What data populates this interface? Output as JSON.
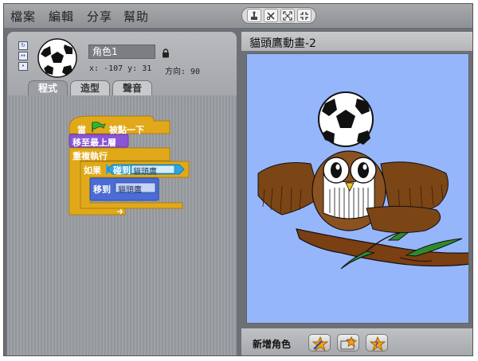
{
  "menu": {
    "items": [
      "檔案",
      "編輯",
      "分享",
      "幫助"
    ]
  },
  "toolbar": {
    "tools": [
      "stamp-icon",
      "scissors-icon",
      "grow-icon",
      "shrink-icon"
    ]
  },
  "sprite": {
    "name": "角色1",
    "coords": "x: -107  y: 31",
    "direction": "方向: 90"
  },
  "tabs": [
    {
      "label": "程式",
      "active": true
    },
    {
      "label": "造型",
      "active": false
    },
    {
      "label": "聲音",
      "active": false
    }
  ],
  "blocks": {
    "when_flag_pre": "當",
    "when_flag_post": "被點一下",
    "go_front": "移至最上層",
    "forever": "重複執行",
    "if_label": "如果",
    "touching_label": "碰到",
    "touching_target": "貓頭鷹",
    "goto_label": "移到",
    "goto_target": "貓頭鷹"
  },
  "stage": {
    "title": "貓頭鷹動畫-2",
    "background": "#96b6fb"
  },
  "new_sprite": {
    "label": "新增角色"
  },
  "colors": {
    "control": "#e1a91a",
    "looks": "#8a55d7",
    "motion": "#4a6cd4",
    "sensing": "#2ca5e2"
  }
}
